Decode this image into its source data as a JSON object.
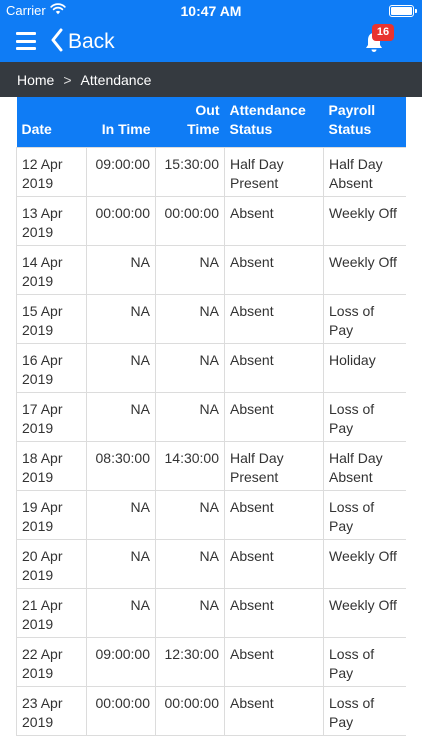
{
  "status_bar": {
    "carrier": "Carrier",
    "time": "10:47 AM"
  },
  "navbar": {
    "back_label": "Back",
    "notification_count": "16"
  },
  "breadcrumb": {
    "home": "Home",
    "separator": ">",
    "current": "Attendance"
  },
  "table": {
    "headers": {
      "date": "Date",
      "in_time": "In Time",
      "out_time_1": "Out",
      "out_time_2": "Time",
      "attendance_1": "Attendance",
      "attendance_2": "Status",
      "payroll_1": "Payroll",
      "payroll_2": "Status"
    },
    "rows": [
      {
        "d1": "12 Apr",
        "d2": "2019",
        "in": "09:00:00",
        "out": "15:30:00",
        "a1": "Half Day",
        "a2": "Present",
        "p1": "Half Day",
        "p2": "Absent"
      },
      {
        "d1": "13 Apr",
        "d2": "2019",
        "in": "00:00:00",
        "out": "00:00:00",
        "a1": "Absent",
        "a2": "",
        "p1": "Weekly Off",
        "p2": ""
      },
      {
        "d1": "14 Apr",
        "d2": "2019",
        "in": "NA",
        "out": "NA",
        "a1": "Absent",
        "a2": "",
        "p1": "Weekly Off",
        "p2": ""
      },
      {
        "d1": "15 Apr",
        "d2": "2019",
        "in": "NA",
        "out": "NA",
        "a1": "Absent",
        "a2": "",
        "p1": "Loss of Pay",
        "p2": ""
      },
      {
        "d1": "16 Apr",
        "d2": "2019",
        "in": "NA",
        "out": "NA",
        "a1": "Absent",
        "a2": "",
        "p1": "Holiday",
        "p2": ""
      },
      {
        "d1": "17 Apr",
        "d2": "2019",
        "in": "NA",
        "out": "NA",
        "a1": "Absent",
        "a2": "",
        "p1": "Loss of Pay",
        "p2": ""
      },
      {
        "d1": "18 Apr",
        "d2": "2019",
        "in": "08:30:00",
        "out": "14:30:00",
        "a1": "Half Day",
        "a2": "Present",
        "p1": "Half Day",
        "p2": "Absent"
      },
      {
        "d1": "19 Apr",
        "d2": "2019",
        "in": "NA",
        "out": "NA",
        "a1": "Absent",
        "a2": "",
        "p1": "Loss of Pay",
        "p2": ""
      },
      {
        "d1": "20 Apr",
        "d2": "2019",
        "in": "NA",
        "out": "NA",
        "a1": "Absent",
        "a2": "",
        "p1": "Weekly Off",
        "p2": ""
      },
      {
        "d1": "21 Apr",
        "d2": "2019",
        "in": "NA",
        "out": "NA",
        "a1": "Absent",
        "a2": "",
        "p1": "Weekly Off",
        "p2": ""
      },
      {
        "d1": "22 Apr",
        "d2": "2019",
        "in": "09:00:00",
        "out": "12:30:00",
        "a1": "Absent",
        "a2": "",
        "p1": "Loss of Pay",
        "p2": ""
      },
      {
        "d1": "23 Apr",
        "d2": "2019",
        "in": "00:00:00",
        "out": "00:00:00",
        "a1": "Absent",
        "a2": "",
        "p1": "Loss of Pay",
        "p2": ""
      }
    ]
  },
  "colors": {
    "primary": "#0f7cf5",
    "breadcrumb_bg": "#353a40",
    "badge": "#e8332f"
  },
  "icons": {
    "menu": "menu-icon",
    "back": "chevron-left-icon",
    "bell": "bell-icon",
    "wifi": "wifi-icon",
    "battery": "battery-icon"
  }
}
